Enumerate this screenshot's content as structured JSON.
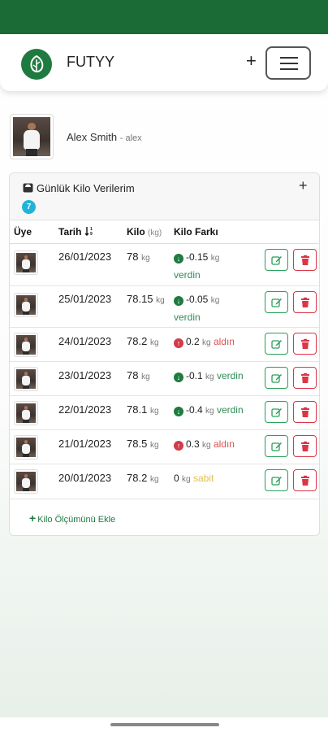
{
  "navbar": {
    "brand": "FUTYY",
    "plus": "+"
  },
  "user": {
    "name": "Alex Smith",
    "handle": "- alex"
  },
  "card": {
    "title": "Günlük Kilo Verilerim",
    "add_plus": "+",
    "count": "7",
    "columns": {
      "member": "Üye",
      "date": "Tarih",
      "kilo": "Kilo",
      "kilo_unit": "(kg)",
      "diff": "Kilo Farkı"
    },
    "rows": [
      {
        "date": "26/01/2023",
        "weight": "78",
        "unit": "kg",
        "diff": "-0.15",
        "diff_unit": "kg",
        "status": "verdin",
        "direction": "down"
      },
      {
        "date": "25/01/2023",
        "weight": "78.15",
        "unit": "kg",
        "diff": "-0.05",
        "diff_unit": "kg",
        "status": "verdin",
        "direction": "down"
      },
      {
        "date": "24/01/2023",
        "weight": "78.2",
        "unit": "kg",
        "diff": "0.2",
        "diff_unit": "kg",
        "status": "aldın",
        "direction": "up"
      },
      {
        "date": "23/01/2023",
        "weight": "78",
        "unit": "kg",
        "diff": "-0.1",
        "diff_unit": "kg",
        "status": "verdin",
        "direction": "down"
      },
      {
        "date": "22/01/2023",
        "weight": "78.1",
        "unit": "kg",
        "diff": "-0.4",
        "diff_unit": "kg",
        "status": "verdin",
        "direction": "down"
      },
      {
        "date": "21/01/2023",
        "weight": "78.5",
        "unit": "kg",
        "diff": "0.3",
        "diff_unit": "kg",
        "status": "aldın",
        "direction": "up"
      },
      {
        "date": "20/01/2023",
        "weight": "78.2",
        "unit": "kg",
        "diff": "0",
        "diff_unit": "kg",
        "status": "sabit",
        "direction": "none"
      }
    ],
    "add_label": "Kilo Ölçümünü Ekle",
    "add_plus_label": "+"
  },
  "colors": {
    "brand_green": "#1b6b37",
    "success": "#28a05a",
    "danger": "#dc3545",
    "info": "#1fb4d8",
    "neutral": "#e0c04a"
  },
  "icons": [
    "leaf-logo-icon",
    "menu-icon",
    "scale-icon",
    "sort-icon",
    "arrow-down-circle-icon",
    "arrow-up-circle-icon",
    "edit-icon",
    "trash-icon"
  ]
}
